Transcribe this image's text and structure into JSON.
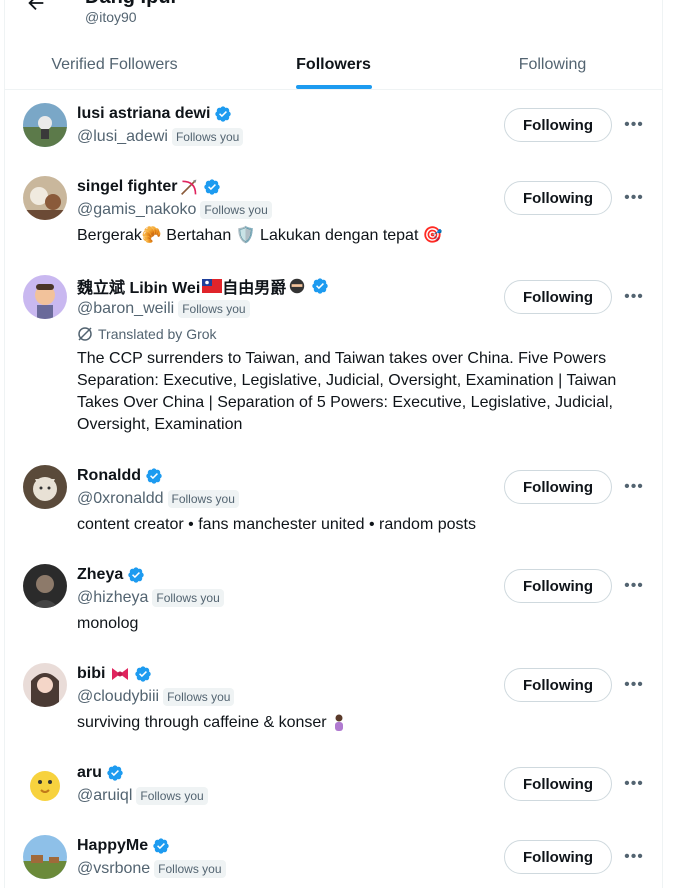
{
  "header": {
    "name": "Dang Ipul",
    "handle": "@itoy90"
  },
  "tabs": [
    {
      "label": "Verified Followers",
      "active": false
    },
    {
      "label": "Followers",
      "active": true
    },
    {
      "label": "Following",
      "active": false
    }
  ],
  "follows_you_label": "Follows you",
  "following_button_label": "Following",
  "users": [
    {
      "name": "lusi astriana dewi",
      "handle": "@lusi_adewi",
      "bio": ""
    },
    {
      "name": "singel fighter",
      "name_emoji": "bow-arrow-icon",
      "handle": "@gamis_nakoko",
      "bio": "Bergerak🥐 Bertahan 🛡️ Lakukan dengan tepat 🎯"
    },
    {
      "name": "魏立斌 Libin Wei",
      "name_suffix": "自由男爵",
      "name_emoji": "taiwan-flag-icon, ninja-icon",
      "handle": "@baron_weili",
      "translated": "Translated by Grok",
      "bio": "The CCP surrenders to Taiwan, and Taiwan takes over China. Five Powers Separation: Executive, Legislative, Judicial, Oversight, Examination | Taiwan Takes Over China | Separation of 5 Powers: Executive, Legislative, Judicial, Oversight, Examination"
    },
    {
      "name": "Ronaldd",
      "handle": "@0xronaldd",
      "bio": "content creator • fans manchester united • random posts"
    },
    {
      "name": "Zheya",
      "handle": "@hizheya",
      "bio": "monolog"
    },
    {
      "name": "bibi",
      "name_emoji": "ribbon-icon",
      "handle": "@cloudybiii",
      "bio": "surviving through caffeine & konser",
      "bio_emoji": "person-icon"
    },
    {
      "name": "aru",
      "handle": "@aruiql",
      "bio": ""
    },
    {
      "name": "HappyMe",
      "handle": "@vsrbone",
      "bio": ""
    }
  ],
  "colors": {
    "accent": "#1d9bf0",
    "text": "#0f1419",
    "muted": "#536471",
    "border": "#eff3f4"
  }
}
